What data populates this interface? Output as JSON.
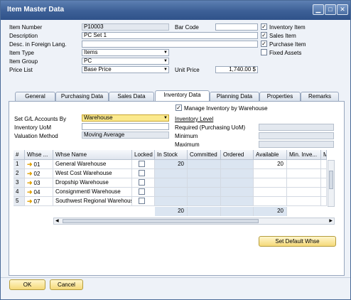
{
  "window": {
    "title": "Item Master Data"
  },
  "header": {
    "item_number_label": "Item Number",
    "item_number": "P10003",
    "description_label": "Description",
    "description": "PC Set 1",
    "foreign_label": "Desc. in Foreign Lang.",
    "foreign": "",
    "item_type_label": "Item Type",
    "item_type": "Items",
    "item_group_label": "Item Group",
    "item_group": "PC",
    "price_list_label": "Price List",
    "price_list": "Base Price",
    "barcode_label": "Bar Code",
    "barcode": "",
    "unit_price_label": "Unit Price",
    "unit_price": "1,740.00 $"
  },
  "flags": [
    {
      "label": "Inventory Item",
      "checked": true
    },
    {
      "label": "Sales Item",
      "checked": true
    },
    {
      "label": "Purchase Item",
      "checked": true
    },
    {
      "label": "Fixed Assets",
      "checked": false
    }
  ],
  "tabs": [
    "General",
    "Purchasing Data",
    "Sales Data",
    "Inventory Data",
    "Planning Data",
    "Properties",
    "Remarks"
  ],
  "inventory": {
    "manage_label": "Manage Inventory by Warehouse",
    "gl_label": "Set G/L Accounts By",
    "gl_value": "Warehouse",
    "uom_label": "Inventory UoM",
    "uom_value": "",
    "valuation_label": "Valuation Method",
    "valuation_value": "Moving Average",
    "level_label": "Inventory Level",
    "required_label": "Required (Purchasing UoM)",
    "minimum_label": "Minimum",
    "maximum_label": "Maximum"
  },
  "grid": {
    "headers": [
      "#",
      "Whse ...",
      "Whse Name",
      "Locked",
      "In Stock",
      "Committed",
      "Ordered",
      "Available",
      "Min. Inve...",
      "M"
    ],
    "rows": [
      {
        "n": "1",
        "code": "01",
        "name": "General Warehouse",
        "in_stock": "20",
        "available": "20"
      },
      {
        "n": "2",
        "code": "02",
        "name": "West Cost Warehouse",
        "in_stock": "",
        "available": ""
      },
      {
        "n": "3",
        "code": "03",
        "name": "Dropship Warehouse",
        "in_stock": "",
        "available": ""
      },
      {
        "n": "4",
        "code": "04",
        "name": "Consignmentl Warehouse",
        "in_stock": "",
        "available": ""
      },
      {
        "n": "5",
        "code": "07",
        "name": "Southwest Regional Warehouse",
        "in_stock": "",
        "available": ""
      }
    ],
    "total_in_stock": "20",
    "total_available": "20"
  },
  "buttons": {
    "set_default": "Set Default Whse",
    "ok": "OK",
    "cancel": "Cancel"
  }
}
